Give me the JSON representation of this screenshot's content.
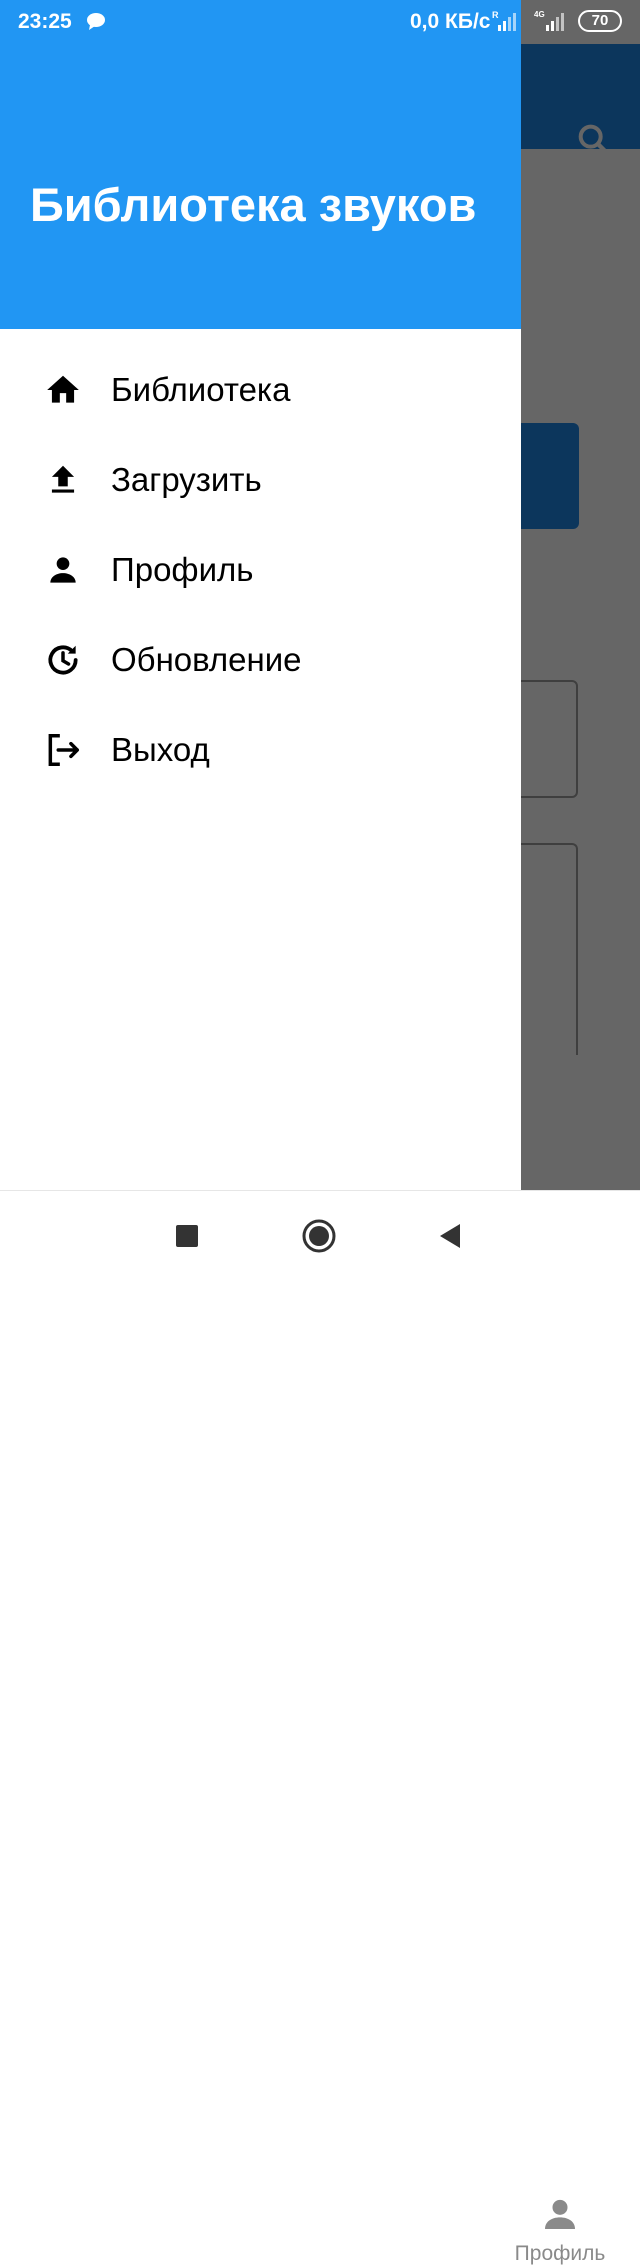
{
  "status_bar": {
    "time": "23:25",
    "net_speed": "0,0 КБ/с",
    "sim1_badge": "R",
    "sim2_badge": "4G",
    "battery": "70"
  },
  "background": {
    "bottom_nav_label": "Профиль"
  },
  "drawer": {
    "title": "Библиотека звуков",
    "header_color": "#2196f3",
    "items": [
      {
        "label": "Библиотека",
        "icon": "home-icon"
      },
      {
        "label": "Загрузить",
        "icon": "upload-icon"
      },
      {
        "label": "Профиль",
        "icon": "person-icon"
      },
      {
        "label": "Обновление",
        "icon": "update-icon"
      },
      {
        "label": "Выход",
        "icon": "logout-icon"
      }
    ]
  },
  "colors": {
    "accent": "#2196f3",
    "appbar": "#1e88e5"
  }
}
